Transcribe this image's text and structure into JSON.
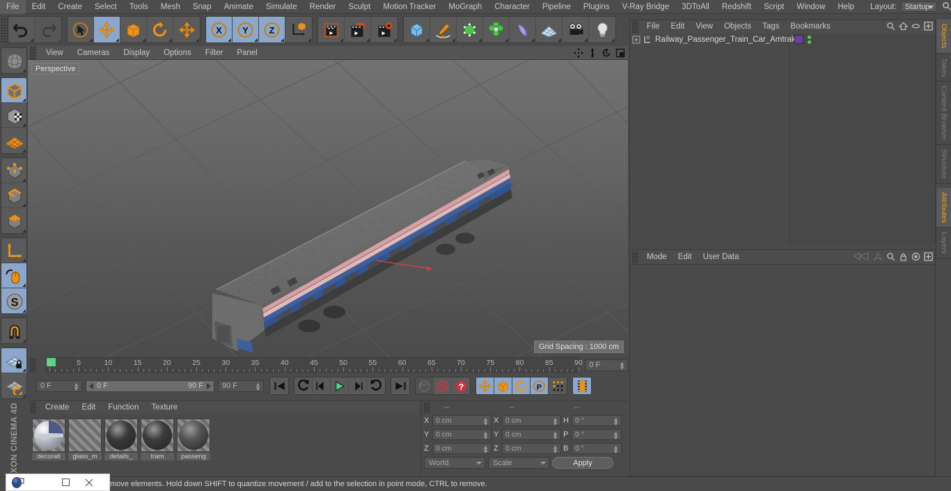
{
  "menubar": {
    "items": [
      "File",
      "Edit",
      "Create",
      "Select",
      "Tools",
      "Mesh",
      "Snap",
      "Animate",
      "Simulate",
      "Render",
      "Sculpt",
      "Motion Tracker",
      "MoGraph",
      "Character",
      "Pipeline",
      "Plugins",
      "V-Ray Bridge",
      "3DToAll",
      "Redshift",
      "Script",
      "Window",
      "Help"
    ],
    "layout_label": "Layout:",
    "layout_value": "Startup"
  },
  "toolbar": {
    "groups": [
      {
        "name": "undo-redo",
        "buttons": [
          {
            "name": "undo-button",
            "icon": "undo-icon",
            "state": "normal"
          },
          {
            "name": "redo-button",
            "icon": "redo-icon",
            "state": "disabled"
          }
        ]
      },
      {
        "name": "transform-tools",
        "buttons": [
          {
            "name": "live-selection-button",
            "icon": "cursor-select-icon",
            "state": "normal"
          },
          {
            "name": "move-tool-button",
            "icon": "move-arrows-icon",
            "state": "selected"
          },
          {
            "name": "scale-tool-button",
            "icon": "scale-box-icon",
            "state": "normal"
          },
          {
            "name": "rotate-tool-button",
            "icon": "rotate-circle-icon",
            "state": "normal"
          },
          {
            "name": "move-extra-button",
            "icon": "move-arrows-icon",
            "state": "normal"
          }
        ]
      },
      {
        "name": "axis-locks",
        "buttons": [
          {
            "name": "x-axis-lock-button",
            "icon": "x-axis-icon",
            "state": "selected"
          },
          {
            "name": "y-axis-lock-button",
            "icon": "y-axis-icon",
            "state": "selected"
          },
          {
            "name": "z-axis-lock-button",
            "icon": "z-axis-icon",
            "state": "selected"
          },
          {
            "name": "world-object-coord-button",
            "icon": "world-axis-cube-icon",
            "state": "normal"
          }
        ]
      },
      {
        "name": "render-tools",
        "buttons": [
          {
            "name": "render-view-button",
            "icon": "clapper-view-icon",
            "state": "normal"
          },
          {
            "name": "render-region-button",
            "icon": "clapper-region-icon",
            "state": "normal"
          },
          {
            "name": "render-settings-button",
            "icon": "clapper-gear-icon",
            "state": "normal"
          }
        ]
      },
      {
        "name": "create-tools",
        "buttons": [
          {
            "name": "add-cube-button",
            "icon": "blue-cube-icon",
            "state": "normal"
          },
          {
            "name": "add-spline-button",
            "icon": "pen-spline-icon",
            "state": "normal"
          },
          {
            "name": "add-generator-button",
            "icon": "green-cube-icon",
            "state": "normal"
          },
          {
            "name": "add-array-button",
            "icon": "green-cluster-icon",
            "state": "normal"
          },
          {
            "name": "add-deformer-button",
            "icon": "bend-deformer-icon",
            "state": "normal"
          },
          {
            "name": "add-floor-button",
            "icon": "grid-floor-icon",
            "state": "normal"
          },
          {
            "name": "add-camera-button",
            "icon": "camera-icon",
            "state": "normal"
          },
          {
            "name": "add-light-button",
            "icon": "lightbulb-icon",
            "state": "normal"
          }
        ]
      }
    ]
  },
  "left_toolbar": {
    "buttons": [
      {
        "name": "make-editable-button",
        "icon": "editable-sphere-icon",
        "state": "disabled"
      },
      {
        "name": "model-mode-button",
        "icon": "model-cube-icon",
        "state": "selected"
      },
      {
        "name": "texture-mode-button",
        "icon": "texture-cube-icon",
        "state": "normal"
      },
      {
        "name": "workplane-mode-button",
        "icon": "workplane-grid-icon",
        "state": "normal"
      },
      {
        "name": "points-mode-button",
        "icon": "points-cube-icon",
        "state": "normal"
      },
      {
        "name": "edges-mode-button",
        "icon": "edges-cube-icon",
        "state": "normal"
      },
      {
        "name": "polygons-mode-button",
        "icon": "polygons-cube-icon",
        "state": "normal"
      },
      {
        "name": "object-axis-button",
        "icon": "axis-corner-icon",
        "state": "normal"
      },
      {
        "name": "viewport-solo-button",
        "icon": "mouse-icon",
        "state": "selected"
      },
      {
        "name": "scale-snap-button",
        "icon": "s-circle-icon",
        "state": "selected"
      },
      {
        "name": "magnet-button",
        "icon": "magnet-icon",
        "state": "normal"
      },
      {
        "name": "workplane-lock-button",
        "icon": "grid-lock-icon",
        "state": "selected"
      },
      {
        "name": "workplane-rotate-button",
        "icon": "grid-rotate-icon",
        "state": "normal"
      }
    ],
    "brand": "CINEMA 4D",
    "brand_top": "MAXON"
  },
  "viewport": {
    "menus": [
      "View",
      "Cameras",
      "Display",
      "Options",
      "Filter",
      "Panel"
    ],
    "camera_label": "Perspective",
    "grid_spacing": "Grid Spacing : 1000 cm",
    "axis_labels": {
      "x": "X",
      "y": "Y",
      "z": "Z"
    },
    "corner_icons": [
      "move-view-icon",
      "pan-view-icon",
      "rotate-view-icon",
      "maximize-view-icon"
    ],
    "model_description": "Amtrak railway passenger train car, gray ribbed roof, blue body with red and white stripe"
  },
  "timeline": {
    "start_frame": "0 F",
    "end_frame": "90 F",
    "current_frame": "0 F",
    "preview_min": "0 F",
    "preview_max": "90 F",
    "ticks": [
      0,
      5,
      10,
      15,
      20,
      25,
      30,
      35,
      40,
      45,
      50,
      55,
      60,
      65,
      70,
      75,
      80,
      85,
      90
    ],
    "controls": [
      {
        "name": "goto-start-button",
        "icon": "skip-start-icon",
        "state": "normal"
      },
      {
        "name": "step-back-keyframe-button",
        "icon": "prev-key-icon",
        "state": "normal"
      },
      {
        "name": "step-back-frame-button",
        "icon": "step-back-icon",
        "state": "normal"
      },
      {
        "name": "play-button",
        "icon": "play-icon",
        "state": "normal"
      },
      {
        "name": "step-forward-frame-button",
        "icon": "step-forward-icon",
        "state": "normal"
      },
      {
        "name": "step-forward-keyframe-button",
        "icon": "next-key-icon",
        "state": "normal"
      },
      {
        "name": "goto-end-button",
        "icon": "skip-end-icon",
        "state": "normal"
      },
      {
        "name": "record-active-objects-button",
        "icon": "key-icon",
        "state": "disabled"
      },
      {
        "name": "autokeying-button",
        "icon": "autokey-icon",
        "state": "normal"
      },
      {
        "name": "keyframe-selection-button",
        "icon": "question-icon",
        "state": "normal"
      },
      {
        "name": "position-key-button",
        "icon": "move-arrows-icon",
        "state": "selected"
      },
      {
        "name": "scale-key-button",
        "icon": "scale-box-icon",
        "state": "selected"
      },
      {
        "name": "rotation-key-button",
        "icon": "rotate-circle-icon",
        "state": "selected"
      },
      {
        "name": "param-key-button",
        "icon": "p-circle-icon",
        "state": "selected"
      },
      {
        "name": "pla-key-button",
        "icon": "dots-grid-icon",
        "state": "normal"
      },
      {
        "name": "timeline-toggle-button",
        "icon": "filmstrip-icon",
        "state": "selected"
      }
    ]
  },
  "material_manager": {
    "menus": [
      "Create",
      "Edit",
      "Function",
      "Texture"
    ],
    "materials": [
      {
        "name": "decorati",
        "color": "#b9bcc4",
        "type": "textured"
      },
      {
        "name": "glass_m",
        "color": "transparent",
        "type": "empty"
      },
      {
        "name": "details_",
        "color": "#3a3a3a",
        "type": "solid"
      },
      {
        "name": "tram",
        "color": "#3c3c3c",
        "type": "solid"
      },
      {
        "name": "passeng",
        "color": "#555555",
        "type": "solid"
      }
    ]
  },
  "coordinates": {
    "header": [
      "--",
      "--",
      "--"
    ],
    "rows": [
      {
        "pos_label": "X",
        "pos_value": "0 cm",
        "size_label": "X",
        "size_value": "0 cm",
        "rot_label": "H",
        "rot_value": "0 °"
      },
      {
        "pos_label": "Y",
        "pos_value": "0 cm",
        "size_label": "Y",
        "size_value": "0 cm",
        "rot_label": "P",
        "rot_value": "0 °"
      },
      {
        "pos_label": "Z",
        "pos_value": "0 cm",
        "size_label": "Z",
        "size_value": "0 cm",
        "rot_label": "B",
        "rot_value": "0 °"
      }
    ],
    "coord_system": "World",
    "transform_mode": "Scale",
    "apply_label": "Apply"
  },
  "object_manager": {
    "menus": [
      "File",
      "Edit",
      "View",
      "Objects",
      "Tags",
      "Bookmarks"
    ],
    "icons": [
      "search-icon",
      "home-icon",
      "ellipse-icon",
      "expand-icon"
    ],
    "object": {
      "name": "Railway_Passenger_Train_Car_Amtrak",
      "layer_badge": "0",
      "tag_color": "#6b3fa0",
      "dot_color": "#5ec94a"
    }
  },
  "attribute_manager": {
    "menus": [
      "Mode",
      "Edit",
      "User Data"
    ],
    "icons": [
      "back-nav-icon",
      "up-nav-icon",
      "search-icon",
      "lock-icon",
      "target-icon",
      "expand-icon"
    ]
  },
  "side_tabs": {
    "top": [
      {
        "label": "Objects",
        "active": true
      },
      {
        "label": "Takes",
        "active": false
      },
      {
        "label": "Content Browser",
        "active": false
      },
      {
        "label": "Structure",
        "active": false
      }
    ],
    "bottom": [
      {
        "label": "Attributes",
        "active": true
      },
      {
        "label": "Layers",
        "active": false
      }
    ]
  },
  "status_bar": {
    "message": "move elements. Hold down SHIFT to quantize movement / add to the selection in point mode, CTRL to remove.",
    "window_controls": [
      "app-icon",
      "minimize-icon",
      "maximize-icon",
      "close-icon"
    ]
  },
  "colors": {
    "accent_orange": "#e0a33a",
    "selected_blue": "#8ba8cc",
    "panel_bg": "#4a4a4a",
    "button_bg": "#5a5a5a",
    "playhead_green": "#4fd97f"
  }
}
